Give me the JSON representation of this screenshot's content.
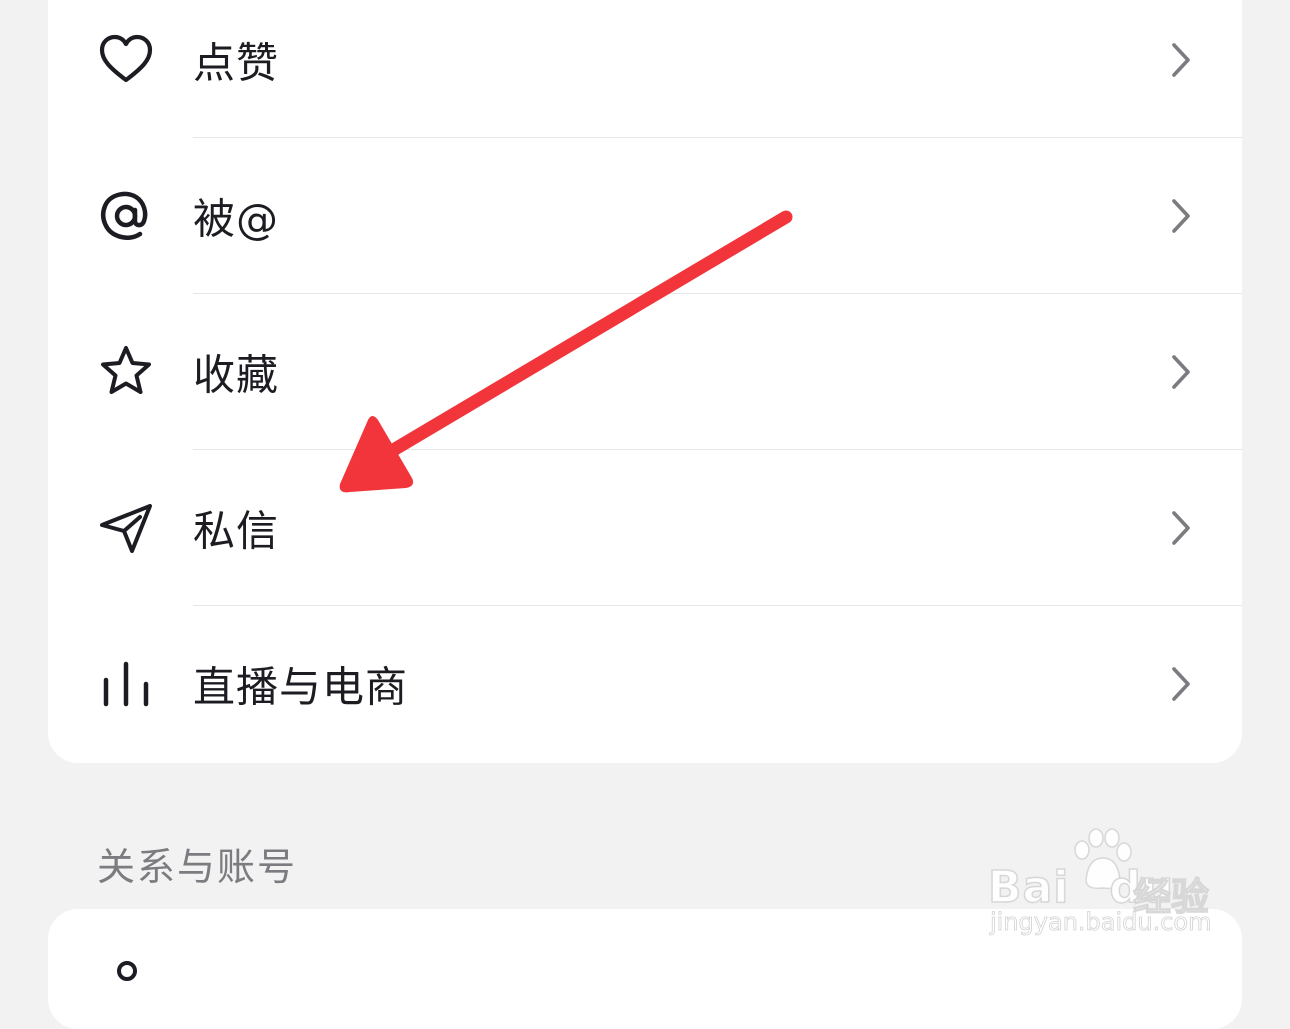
{
  "menu": {
    "items": [
      {
        "label": "点赞",
        "icon": "heart-icon"
      },
      {
        "label": "被@",
        "icon": "at-icon"
      },
      {
        "label": "收藏",
        "icon": "star-icon"
      },
      {
        "label": "私信",
        "icon": "paper-plane-icon"
      },
      {
        "label": "直播与电商",
        "icon": "live-bars-icon"
      }
    ],
    "chevron_icon": "chevron-right-icon"
  },
  "section": {
    "title": "关系与账号"
  },
  "watermark": {
    "brand": "Bai",
    "brand_suffix": "du",
    "product": "经验",
    "url": "jingyan.baidu.com"
  },
  "colors": {
    "background": "#f2f2f2",
    "card": "#ffffff",
    "text": "#1c1c22",
    "section_title": "#7b7b80",
    "divider": "#e6e6e6",
    "annotation_arrow": "#f2353a"
  }
}
